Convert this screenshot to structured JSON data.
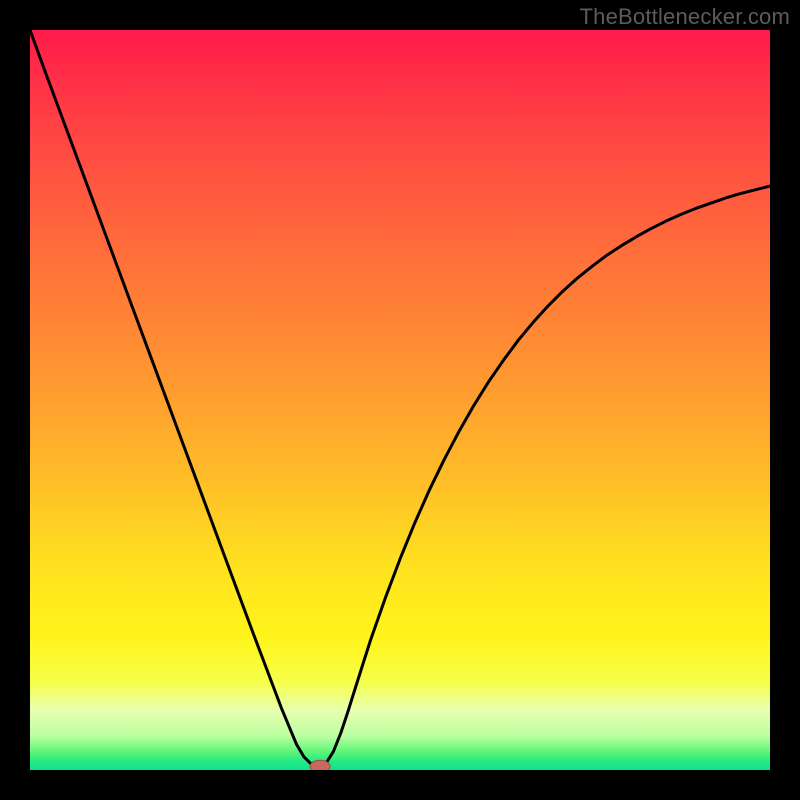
{
  "watermark": "TheBottlenecker.com",
  "colors": {
    "frame": "#000000",
    "curve": "#000000",
    "marker_fill": "#c76a5e",
    "marker_stroke": "#9c4a41",
    "gradient_stops": [
      {
        "offset": 0.0,
        "color": "#ff1a4b"
      },
      {
        "offset": 0.1,
        "color": "#ff3a45"
      },
      {
        "offset": 0.22,
        "color": "#ff5a3f"
      },
      {
        "offset": 0.35,
        "color": "#ff7a38"
      },
      {
        "offset": 0.48,
        "color": "#ff9a30"
      },
      {
        "offset": 0.6,
        "color": "#ffbb28"
      },
      {
        "offset": 0.72,
        "color": "#ffe020"
      },
      {
        "offset": 0.82,
        "color": "#fff41a"
      },
      {
        "offset": 0.88,
        "color": "#f7ff4a"
      },
      {
        "offset": 0.92,
        "color": "#e8ffb0"
      },
      {
        "offset": 0.955,
        "color": "#b8ffa0"
      },
      {
        "offset": 0.975,
        "color": "#60f57a"
      },
      {
        "offset": 0.99,
        "color": "#20e884"
      },
      {
        "offset": 1.0,
        "color": "#10e090"
      }
    ]
  },
  "chart_data": {
    "type": "line",
    "title": "",
    "xlabel": "",
    "ylabel": "",
    "xlim": [
      0,
      100
    ],
    "ylim": [
      0,
      100
    ],
    "x": [
      0,
      2,
      4,
      6,
      8,
      10,
      12,
      14,
      16,
      18,
      20,
      22,
      24,
      26,
      28,
      30,
      32,
      34,
      36,
      37,
      38,
      39,
      40,
      41,
      42,
      43,
      44,
      46,
      48,
      50,
      52,
      54,
      56,
      58,
      60,
      62,
      64,
      66,
      68,
      70,
      72,
      74,
      76,
      78,
      80,
      82,
      84,
      86,
      88,
      90,
      92,
      94,
      96,
      98,
      100
    ],
    "values": [
      100,
      94.5,
      89.1,
      83.7,
      78.3,
      72.9,
      67.5,
      62.1,
      56.7,
      51.3,
      45.9,
      40.5,
      35.1,
      29.7,
      24.3,
      18.9,
      13.6,
      8.3,
      3.5,
      1.8,
      0.8,
      0.5,
      0.9,
      2.5,
      5.0,
      8.0,
      11.2,
      17.5,
      23.2,
      28.5,
      33.4,
      37.9,
      42.0,
      45.8,
      49.3,
      52.5,
      55.4,
      58.1,
      60.5,
      62.7,
      64.7,
      66.5,
      68.1,
      69.6,
      70.9,
      72.1,
      73.2,
      74.2,
      75.1,
      75.9,
      76.6,
      77.3,
      77.9,
      78.4,
      78.9
    ],
    "marker": {
      "x": 39.2,
      "y": 0.5
    }
  }
}
